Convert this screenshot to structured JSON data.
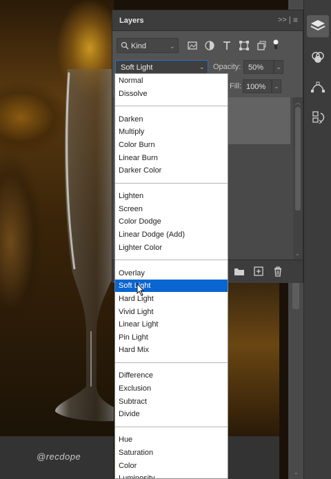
{
  "watermark": "@recdope",
  "layers_panel": {
    "title": "Layers",
    "filter": {
      "kind_label": "Kind"
    },
    "blend_mode": "Soft Light",
    "opacity_label": "Opacity:",
    "opacity_value": "50%",
    "fill_label": "Fill:",
    "fill_value": "100%"
  },
  "blend_menu": {
    "selected": "Soft Light",
    "groups": [
      [
        "Normal",
        "Dissolve"
      ],
      [
        "Darken",
        "Multiply",
        "Color Burn",
        "Linear Burn",
        "Darker Color"
      ],
      [
        "Lighten",
        "Screen",
        "Color Dodge",
        "Linear Dodge (Add)",
        "Lighter Color"
      ],
      [
        "Overlay",
        "Soft Light",
        "Hard Light",
        "Vivid Light",
        "Linear Light",
        "Pin Light",
        "Hard Mix"
      ],
      [
        "Difference",
        "Exclusion",
        "Subtract",
        "Divide"
      ],
      [
        "Hue",
        "Saturation",
        "Color",
        "Luminosity"
      ]
    ]
  },
  "colors": {
    "selection": "#0a65d0",
    "panel": "#535353",
    "focus": "#2a6fc9"
  }
}
